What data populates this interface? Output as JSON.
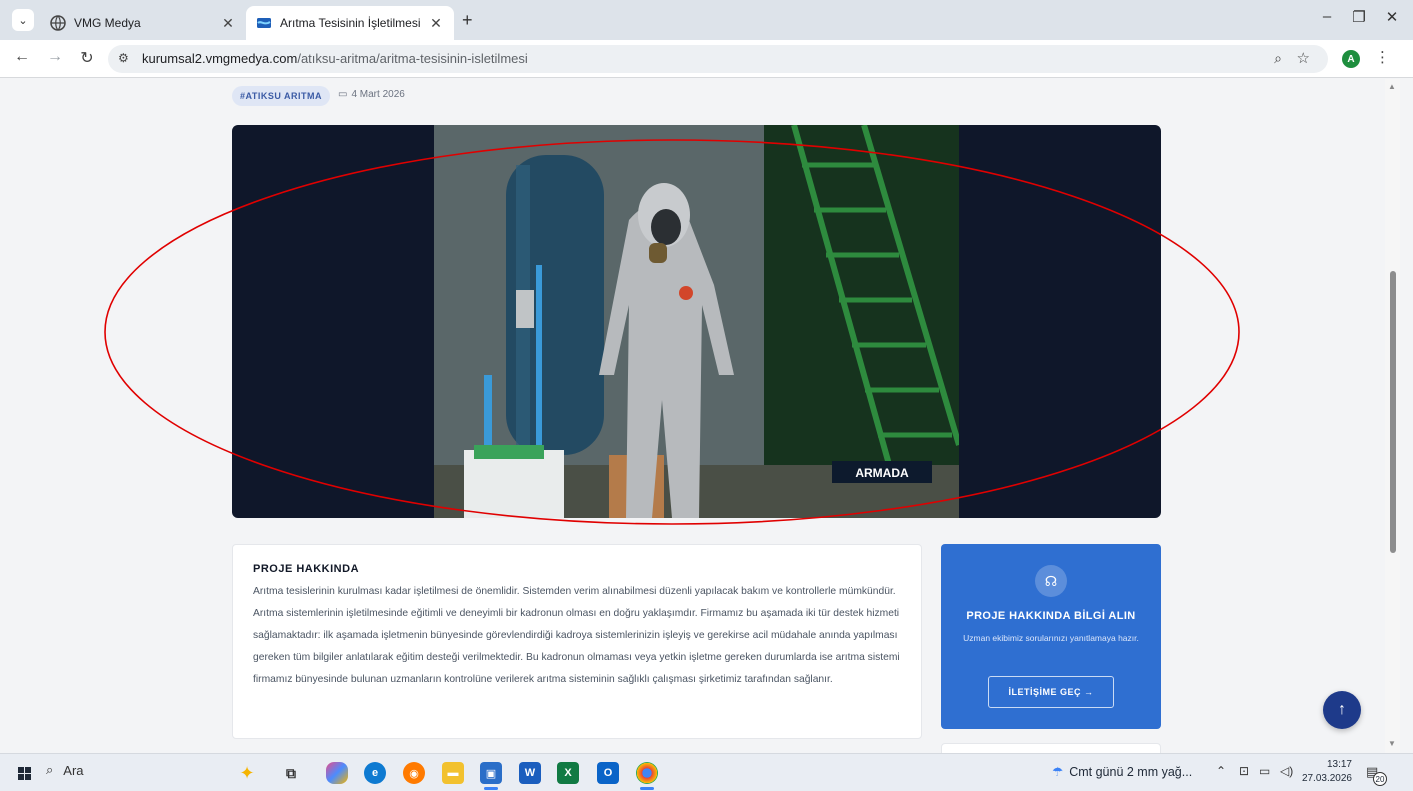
{
  "browser": {
    "tabs": [
      {
        "title": "VMG Medya",
        "active": false
      },
      {
        "title": "Arıtma Tesisinin İşletilmesi",
        "active": true
      }
    ],
    "url_host": "kurumsal2.vmgmedya.com",
    "url_path": "/atıksu-aritma/aritma-tesisinin-isletilmesi",
    "profile_initial": "A",
    "icons": [
      "tab-search-icon",
      "back-icon",
      "forward-icon",
      "reload-icon",
      "site-info-icon",
      "zoom-icon",
      "bookmark-star-icon",
      "menu-kebab-icon",
      "minimize-icon",
      "restore-icon",
      "close-icon"
    ]
  },
  "article": {
    "tag": "#ATIKSU ARITMA",
    "date": "4 Mart 2026",
    "image_watermark": "ARMADA"
  },
  "about": {
    "title": "PROJE HAKKINDA",
    "body": "Arıtma tesislerinin kurulması kadar işletilmesi de önemlidir. Sistemden verim alınabilmesi düzenli yapılacak bakım ve kontrollerle mümkündür. Arıtma sistemlerinin işletilmesinde eğitimli ve deneyimli bir kadronun olması en doğru yaklaşımdır. Firmamız bu aşamada iki tür destek hizmeti sağlamaktadır: ilk aşamada işletmenin bünyesinde görevlendirdiği kadroya sistemlerinizin işleyiş ve gerekirse acil müdahale anında yapılması gereken tüm bilgiler anlatılarak eğitim desteği verilmektedir. Bu kadronun olmaması veya yetkin işletme gereken durumlarda ise arıtma sistemi firmamız bünyesinde bulunan uzmanların kontrolüne verilerek arıtma sisteminin sağlıklı çalışması şirketimiz tarafından sağlanır."
  },
  "cta": {
    "title": "PROJE HAKKINDA BİLGİ ALIN",
    "subtitle": "Uzman ekibimiz sorularınızı yanıtlamaya hazır.",
    "button": "İLETİŞİME GEÇ →",
    "accent": "#2f6fd1"
  },
  "taskbar": {
    "search_label": "Ara",
    "weather": "Cmt günü 2 mm yağ...",
    "time": "13:17",
    "date": "27.03.2026",
    "notification_count": "20"
  },
  "colors": {
    "hero_bg": "#0f172a",
    "annotation": "#e00000",
    "fab": "#1e3a8a"
  }
}
